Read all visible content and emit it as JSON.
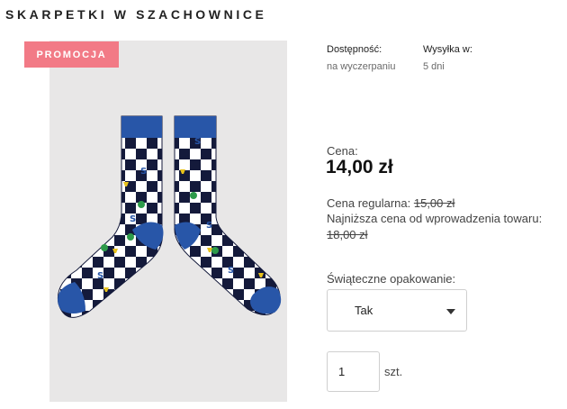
{
  "product": {
    "title": "SKARPETKI W SZACHOWNICE",
    "badge": "PROMOCJA"
  },
  "availability": {
    "label": "Dostępność:",
    "value": "na wyczerpaniu"
  },
  "shipping": {
    "label": "Wysyłka w:",
    "value": "5 dni"
  },
  "pricing": {
    "price_label": "Cena:",
    "price": "14,00 zł",
    "regular_label": "Cena regularna:",
    "regular_value": "15,00 zł",
    "lowest_label": "Najniższa cena od wprowadzenia towaru:",
    "lowest_value": "18,00 zł"
  },
  "options": {
    "wrapping_label": "Świąteczne opakowanie:",
    "wrapping_value": "Tak"
  },
  "quantity": {
    "value": "1",
    "unit": "szt."
  },
  "colors": {
    "badge": "#f27a86",
    "sock_navy": "#141a3b",
    "sock_blue": "#2856a8",
    "image_bg": "#e8e7e7"
  }
}
